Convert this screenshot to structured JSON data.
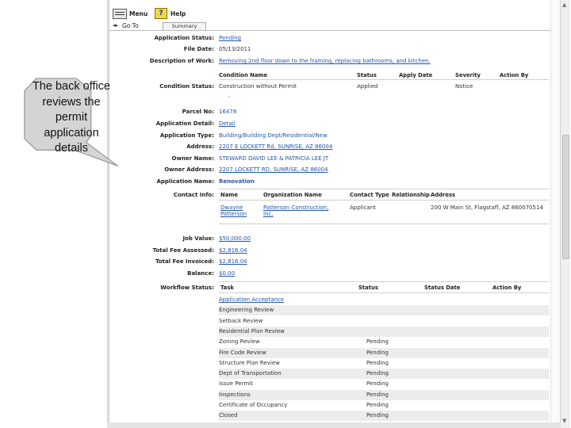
{
  "toolbar": {
    "menu_label": "Menu",
    "help_label": "Help",
    "goto_label": "Go To"
  },
  "tabs": [
    {
      "label": "Summary"
    }
  ],
  "fields": [
    {
      "label": "Application Status:",
      "value": "Pending"
    },
    {
      "label": "File Date:",
      "value": "05/13/2011"
    },
    {
      "label": "Description of Work:",
      "value": "Removing 2nd floor down to the framing, replacing bathrooms, and kitchen."
    }
  ],
  "condition": {
    "label": "Condition Status:",
    "headers": [
      "Condition Name",
      "Status",
      "Apply Date",
      "Severity",
      "Action By"
    ],
    "row": {
      "name": "Construction without Permit",
      "status": "Applied",
      "apply_date": "",
      "severity": "Notice",
      "action_by": ""
    },
    "dot": "."
  },
  "details": [
    {
      "label": "Parcel No:",
      "value": "16478",
      "style": "plain"
    },
    {
      "label": "Application Detail:",
      "value": "Detail",
      "style": "link"
    },
    {
      "label": "Application Type:",
      "value": "Building/Building Dept/Residential/New",
      "style": "plain"
    },
    {
      "label": "Address:",
      "value": "2207 E LOCKETT Rd, SUNRISE, AZ 86004",
      "style": "link"
    },
    {
      "label": "Owner Name:",
      "value": "STEWARD DAVID LEE & PATRICIA LEE JT",
      "style": "plain"
    },
    {
      "label": "Owner Address:",
      "value": "2207 LOCKETT RD, SUNRISE, AZ 86004",
      "style": "link"
    },
    {
      "label": "Application Name:",
      "value": "Renovation",
      "style": "plain"
    }
  ],
  "contact": {
    "label": "Contact Info:",
    "headers": [
      "Name",
      "Organization Name",
      "Contact Type",
      "Relationship",
      "Address"
    ],
    "row": {
      "name_line1": "Dwayne",
      "name_line2": "Patterson",
      "org_line1": "Patterson Construction,",
      "org_line2": "Inc.",
      "type": "Applicant",
      "relationship": "",
      "address": "200 W Main St, Flagstaff, AZ 860070514"
    }
  },
  "fees": [
    {
      "label": "Job Value:",
      "value": "$50,000.00"
    },
    {
      "label": "Total Fee Assessed:",
      "value": "$2,816.04"
    },
    {
      "label": "Total Fee Invoiced:",
      "value": "$2,816.04"
    },
    {
      "label": "Balance:",
      "value": "$0.00"
    }
  ],
  "workflow": {
    "label": "Workflow Status:",
    "headers": [
      "Task",
      "Status",
      "Status Date",
      "Action By"
    ],
    "rows": [
      {
        "task": "Application Acceptance",
        "status": "",
        "link": true
      },
      {
        "task": "Engineering Review",
        "status": ""
      },
      {
        "task": "Setback Review",
        "status": ""
      },
      {
        "task": "Residential Plan Review",
        "status": ""
      },
      {
        "task": "Zoning Review",
        "status": "Pending"
      },
      {
        "task": "Fire Code Review",
        "status": "Pending"
      },
      {
        "task": "Structure Plan Review",
        "status": "Pending"
      },
      {
        "task": "Dept of Transportation",
        "status": "Pending"
      },
      {
        "task": "Issue Permit",
        "status": "Pending"
      },
      {
        "task": "Inspections",
        "status": "Pending"
      },
      {
        "task": "Certificate of Occupancy",
        "status": "Pending"
      },
      {
        "task": "Closed",
        "status": "Pending"
      }
    ]
  },
  "callout": {
    "text": "The back office reviews the permit application details"
  },
  "colors": {
    "link": "#2255aa",
    "bubble_fill": "#d4d4d4",
    "bubble_stroke": "#8c8c8c"
  }
}
